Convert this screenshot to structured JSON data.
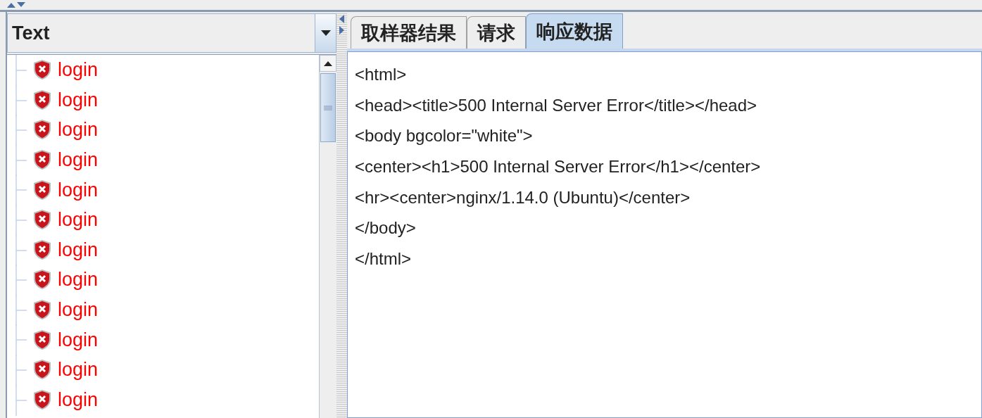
{
  "filter_combo": {
    "value": "Text"
  },
  "tree": {
    "items": [
      {
        "label": "login",
        "failed": true
      },
      {
        "label": "login",
        "failed": true
      },
      {
        "label": "login",
        "failed": true
      },
      {
        "label": "login",
        "failed": true
      },
      {
        "label": "login",
        "failed": true
      },
      {
        "label": "login",
        "failed": true
      },
      {
        "label": "login",
        "failed": true
      },
      {
        "label": "login",
        "failed": true
      },
      {
        "label": "login",
        "failed": true
      },
      {
        "label": "login",
        "failed": true
      },
      {
        "label": "login",
        "failed": true
      },
      {
        "label": "login",
        "failed": true
      }
    ]
  },
  "tabs": [
    {
      "label": "取样器结果",
      "selected": false
    },
    {
      "label": "请求",
      "selected": false
    },
    {
      "label": "响应数据",
      "selected": true
    }
  ],
  "response_lines": [
    "<html>",
    "<head><title>500 Internal Server Error</title></head>",
    "<body bgcolor=\"white\">",
    "<center><h1>500 Internal Server Error</h1></center>",
    "<hr><center>nginx/1.14.0 (Ubuntu)</center>",
    "</body>",
    "</html>"
  ]
}
